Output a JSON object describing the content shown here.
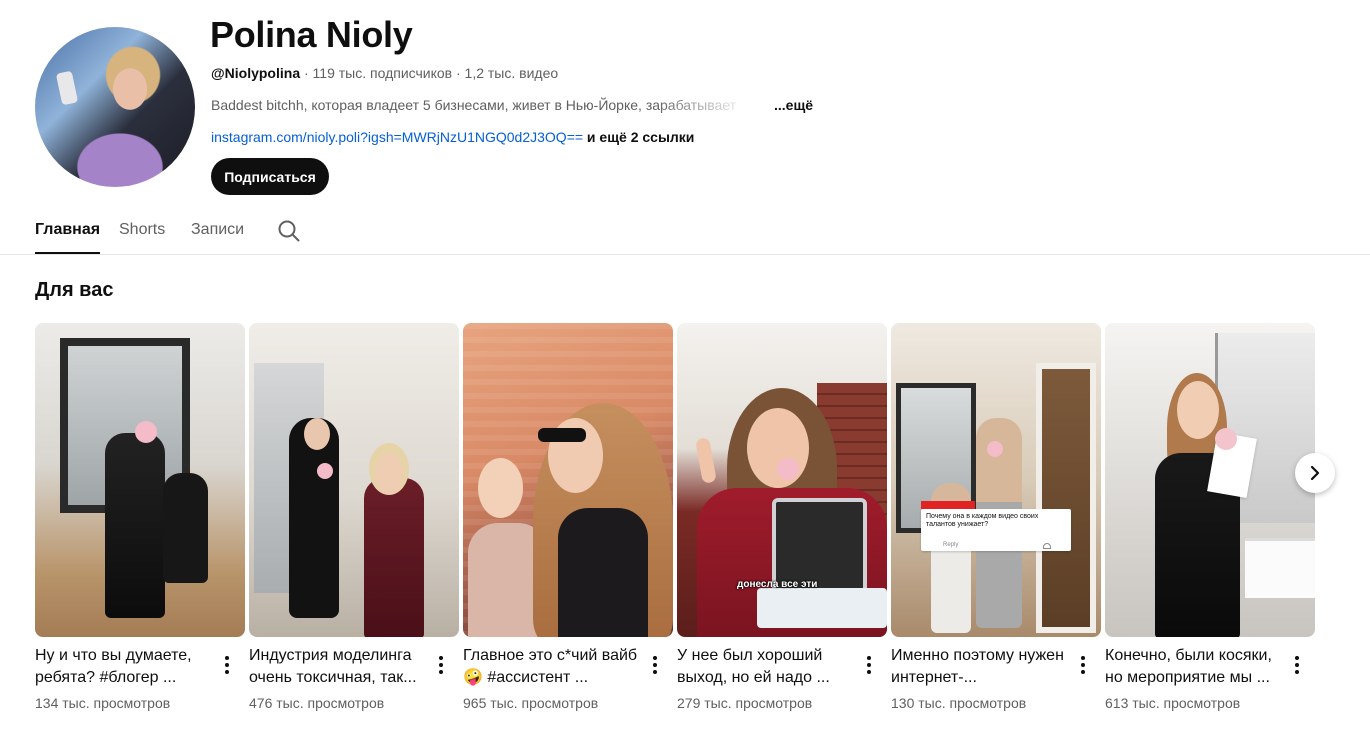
{
  "channel": {
    "name": "Polina Nioly",
    "handle": "@Niolypolina",
    "stats": " · 119 тыс. подписчиков · 1,2 тыс. видео",
    "description": "Baddest bitchh, которая владеет 5 бизнесами, живет в Нью-Йорке, зарабатывает",
    "description_more": "...ещё",
    "link_url": "instagram.com/nioly.poli?igsh=MWRjNzU1NGQ0d2J3OQ==",
    "link_more": " и ещё 2 ссылки",
    "subscribe_label": "Подписаться"
  },
  "tabs": [
    {
      "label": "Главная",
      "active": true
    },
    {
      "label": "Shorts",
      "active": false
    },
    {
      "label": "Записи",
      "active": false
    }
  ],
  "section": {
    "title": "Для вас"
  },
  "videos": [
    {
      "title": "Ну и что вы думаете, ребята? #блогер ...",
      "views": "134 тыс. просмотров"
    },
    {
      "title": "Индустрия моделинга очень токсичная, так...",
      "views": "476 тыс. просмотров"
    },
    {
      "title": "Главное это с*чий вайб 🤪 #ассистент ...",
      "views": "965 тыс. просмотров"
    },
    {
      "title": "У нее был хороший выход, но ей надо ...",
      "views": "279 тыс. просмотров"
    },
    {
      "title": "Именно поэтому нужен интернет-...",
      "views": "130 тыс. просмотров"
    },
    {
      "title": "Конечно, были косяки, но мероприятие мы ...",
      "views": "613 тыс. просмотров"
    }
  ],
  "thumb_text": {
    "video4_caption": "донесла все эти",
    "video5_comment": "Почему она в каждом видео своих талантов унижает?",
    "video5_reply": "Reply"
  },
  "icons": {
    "tab_search": "search-icon",
    "next": "chevron-right-icon",
    "card_menu": "more-vert-icon"
  },
  "colors": {
    "link": "#065fd4",
    "subscribe_bg": "#0f0f0f",
    "secondary_text": "#606060"
  }
}
